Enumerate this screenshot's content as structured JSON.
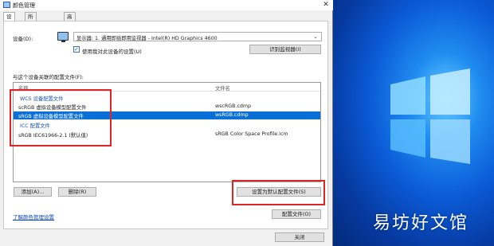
{
  "window": {
    "title": "颜色管理",
    "close_glyph": "✕"
  },
  "tabs": [
    {
      "label": "设备",
      "active": true
    },
    {
      "label": "所有配置文件",
      "active": false
    },
    {
      "label": "高级",
      "active": false
    }
  ],
  "device": {
    "label": "设备(D):",
    "selected": "显示器: 1. 通用即插即用监视器 - Intel(R) HD Graphics 4600",
    "use_my_settings_label": "使用我对此设备的设置(U)",
    "use_my_settings_checked": true,
    "identify_button": "识别监视器(I)"
  },
  "profiles": {
    "section_label": "与这个设备关联的配置文件(F):",
    "columns": [
      "名称",
      "文件名"
    ],
    "rows": [
      {
        "type": "group",
        "name": "WCS 设备配置文件",
        "file": ""
      },
      {
        "type": "item",
        "name": "scRGB 虚拟设备模型配置文件",
        "file": "wscRGB.cdmp",
        "selected": false
      },
      {
        "type": "item",
        "name": "sRGB 虚拟设备模型配置文件",
        "file": "wsRGB.cdmp",
        "selected": true
      },
      {
        "type": "group",
        "name": "ICC 配置文件",
        "file": ""
      },
      {
        "type": "item",
        "name": "sRGB IEC61966-2.1 (默认值)",
        "file": "sRGB Color Space Profile.icm",
        "selected": false
      }
    ]
  },
  "buttons": {
    "add": "添加(A)...",
    "remove": "删除(R)",
    "set_default": "设置为默认配置文件(S)",
    "profiles": "配置文件(O)",
    "close": "关闭"
  },
  "footer_link": "了解颜色管理设置",
  "watermark": "易坊好文馆",
  "colors": {
    "accent": "#0a6fd6",
    "highlight_border": "#e02424",
    "desktop": "#0b5ad6"
  }
}
